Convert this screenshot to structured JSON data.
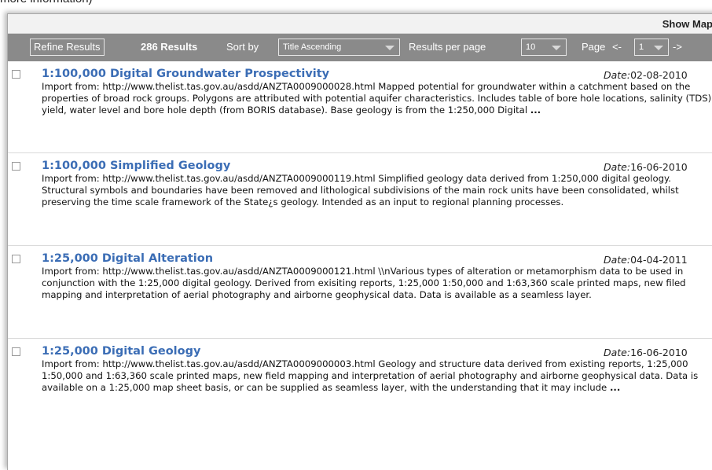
{
  "page_top_text": "more information)",
  "header": {
    "show_map_label": "Show Map"
  },
  "toolbar": {
    "refine_label": "Refine Results",
    "results_count": "286 Results",
    "sort_label": "Sort by",
    "sort_value": "Title Ascending",
    "per_page_label": "Results per page",
    "per_page_value": "10",
    "page_label": "Page",
    "prev_label": "<-",
    "page_value": "1",
    "next_label": "->"
  },
  "results": [
    {
      "title": "1:100,000 Digital Groundwater Prospectivity",
      "date_label": "Date:",
      "date": "02-08-2010",
      "description": "Import from: http://www.thelist.tas.gov.au/asdd/ANZTA0009000028.html Mapped potential for groundwater within a catchment based on the properties of broad rock groups. Polygons are attributed with potential aquifer characteristics. Includes table of bore hole locations, salinity (TDS), yield, water level and bore hole depth (from BORIS database). Base geology is from the 1:250,000 Digital",
      "more": "..."
    },
    {
      "title": "1:100,000 Simplified Geology",
      "date_label": "Date:",
      "date": "16-06-2010",
      "description": "Import from: http://www.thelist.tas.gov.au/asdd/ANZTA0009000119.html Simplified geology data derived from 1:250,000 digital geology. Structural symbols and boundaries have been removed and lithological subdivisions of the main rock units have been consolidated, whilst preserving the time scale framework of the State¿s geology. Intended as an input to regional planning processes.",
      "more": ""
    },
    {
      "title": "1:25,000 Digital Alteration",
      "date_label": "Date:",
      "date": "04-04-2011",
      "description": "Import from: http://www.thelist.tas.gov.au/asdd/ANZTA0009000121.html \\\\nVarious types of alteration or metamorphism data to be used in conjunction with the 1:25,000 digital geology. Derived from exisiting reports, 1:25,000 1:50,000 and 1:63,360 scale printed maps, new filed mapping and interpretation of aerial photography and airborne geophysical data. Data is available as a seamless layer.",
      "more": ""
    },
    {
      "title": "1:25,000 Digital Geology",
      "date_label": "Date:",
      "date": "16-06-2010",
      "description": "Import from: http://www.thelist.tas.gov.au/asdd/ANZTA0009000003.html Geology and structure data derived from existing reports, 1:25,000 1:50,000 and 1:63,360 scale printed maps, new field mapping and interpretation of aerial photography and airborne geophysical data. Data is available on a 1:25,000 map sheet basis, or can be supplied as seamless layer, with the understanding that it may include",
      "more": "..."
    }
  ]
}
